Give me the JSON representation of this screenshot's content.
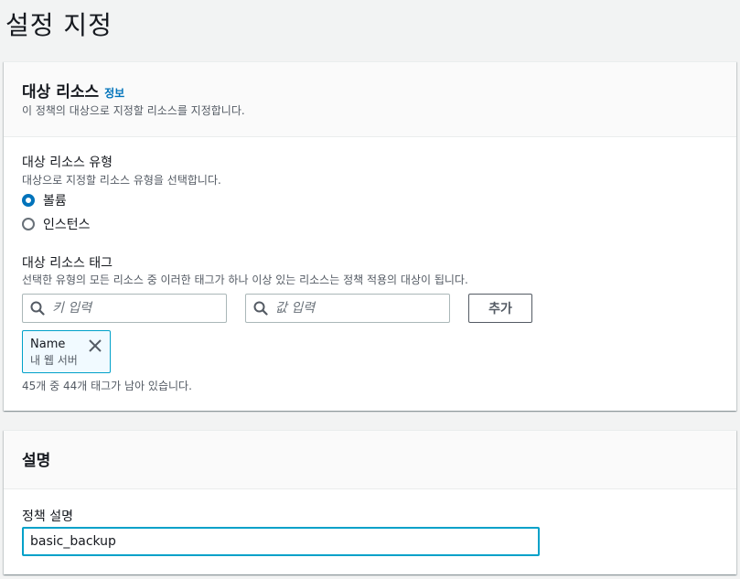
{
  "page": {
    "title": "설정 지정"
  },
  "target_section": {
    "title": "대상 리소스",
    "info_link": "정보",
    "description": "이 정책의 대상으로 지정할 리소스를 지정합니다.",
    "resource_type": {
      "label": "대상 리소스 유형",
      "description": "대상으로 지정할 리소스 유형을 선택합니다.",
      "options": [
        {
          "label": "볼륨",
          "checked": true
        },
        {
          "label": "인스턴스",
          "checked": false
        }
      ]
    },
    "tags": {
      "label": "대상 리소스 태그",
      "description": "선택한 유형의 모든 리소스 중 이러한 태그가 하나 이상 있는 리소스는 정책 적용의 대상이 됩니다.",
      "key_placeholder": "키 입력",
      "value_placeholder": "값 입력",
      "add_button": "추가",
      "token": {
        "key": "Name",
        "value": "내 웹 서버"
      },
      "remaining": "45개 중 44개 태그가 남아 있습니다."
    }
  },
  "description_section": {
    "title": "설명",
    "field_label": "정책 설명",
    "field_value": "basic_backup"
  },
  "colors": {
    "accent": "#0073bb",
    "focus": "#00a1c9",
    "background": "#f2f3f3"
  },
  "icons": [
    "search-icon",
    "close-icon"
  ]
}
